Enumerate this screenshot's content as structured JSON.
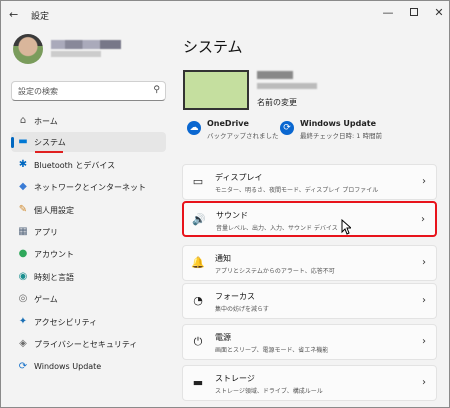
{
  "window": {
    "title": "設定",
    "back_glyph": "←",
    "min_glyph": "—",
    "close_glyph": "✕"
  },
  "sidebar": {
    "search_placeholder": "設定の検索",
    "items": [
      {
        "label": "ホーム",
        "icon": "home-icon",
        "glyph": "⌂",
        "color": "#555555"
      },
      {
        "label": "システム",
        "icon": "system-icon",
        "glyph": "▬",
        "color": "#0078d4"
      },
      {
        "label": "Bluetooth とデバイス",
        "icon": "bluetooth-icon",
        "glyph": "✱",
        "color": "#0067c0"
      },
      {
        "label": "ネットワークとインターネット",
        "icon": "wifi-icon",
        "glyph": "◆",
        "color": "#3a7bd5"
      },
      {
        "label": "個人用設定",
        "icon": "brush-icon",
        "glyph": "✎",
        "color": "#d08a2e"
      },
      {
        "label": "アプリ",
        "icon": "apps-icon",
        "glyph": "▦",
        "color": "#5a6b80"
      },
      {
        "label": "アカウント",
        "icon": "account-icon",
        "glyph": "●",
        "color": "#2fa85b"
      },
      {
        "label": "時刻と言語",
        "icon": "globe-icon",
        "glyph": "◉",
        "color": "#1a8f8f"
      },
      {
        "label": "ゲーム",
        "icon": "gamepad-icon",
        "glyph": "◎",
        "color": "#666666"
      },
      {
        "label": "アクセシビリティ",
        "icon": "accessibility-icon",
        "glyph": "✦",
        "color": "#1a6fb5"
      },
      {
        "label": "プライバシーとセキュリティ",
        "icon": "shield-icon",
        "glyph": "◈",
        "color": "#6b6b6b"
      },
      {
        "label": "Windows Update",
        "icon": "update-icon",
        "glyph": "⟳",
        "color": "#1a73c9"
      }
    ],
    "active_index": 1
  },
  "main": {
    "title": "システム",
    "rename": "名前の変更",
    "quick": [
      {
        "title": "OneDrive",
        "desc": "バックアップされました",
        "icon": "onedrive-icon",
        "glyph": "☁",
        "color": "#0a67d0"
      },
      {
        "title": "Windows Update",
        "desc": "最終チェック日時: 1 時間前",
        "icon": "update-icon",
        "glyph": "⟳",
        "color": "#0a67d0"
      }
    ],
    "cards": [
      {
        "title": "ディスプレイ",
        "desc": "モニター、明るさ、夜間モード、ディスプレイ プロファイル",
        "icon": "display-icon",
        "glyph": "▭"
      },
      {
        "title": "サウンド",
        "desc": "音量レベル、出力、入力、サウンド デバイス",
        "icon": "speaker-icon",
        "glyph": "🔊"
      },
      {
        "title": "通知",
        "desc": "アプリとシステムからのアラート、応答不可",
        "icon": "bell-icon",
        "glyph": "🔔"
      },
      {
        "title": "フォーカス",
        "desc": "集中の妨げを減らす",
        "icon": "focus-icon",
        "glyph": "◔"
      },
      {
        "title": "電源",
        "desc": "画面とスリープ、電源モード、省エネ機能",
        "icon": "power-icon",
        "glyph": "⏻"
      },
      {
        "title": "ストレージ",
        "desc": "ストレージ領域、ドライブ、構成ルール",
        "icon": "storage-icon",
        "glyph": "▬"
      }
    ],
    "chevron": "›",
    "highlight_color": "#e8131b"
  }
}
